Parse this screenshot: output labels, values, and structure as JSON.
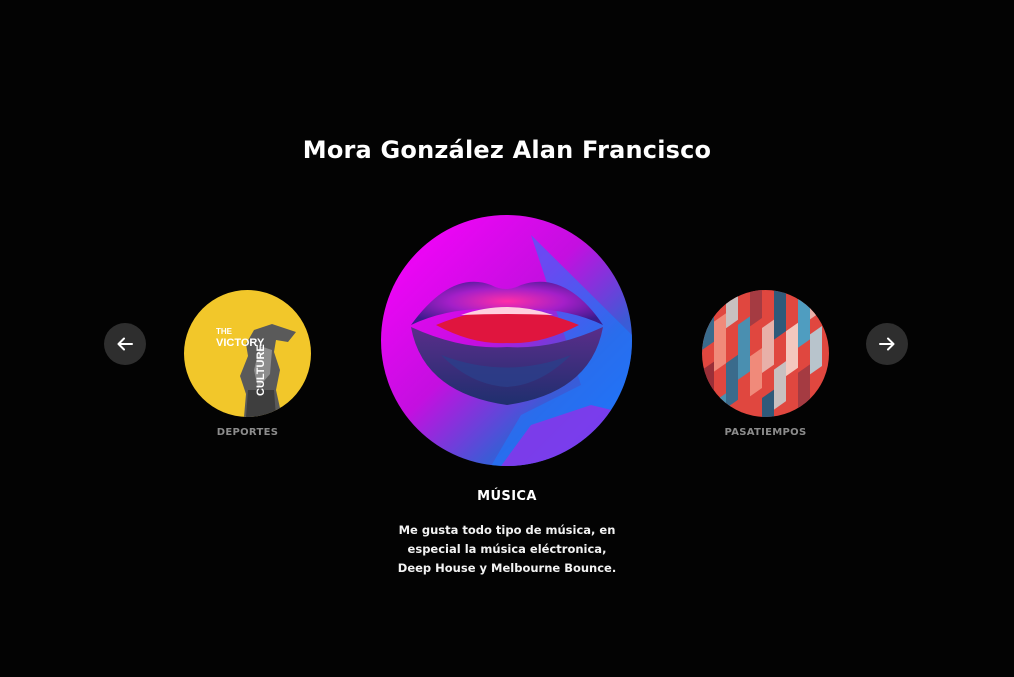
{
  "profile": {
    "name": "Mora González Alan Francisco"
  },
  "carousel": {
    "prev_icon": "arrow-left-icon",
    "next_icon": "arrow-right-icon",
    "slides": [
      {
        "label": "DEPORTES",
        "poster_line1": "THE",
        "poster_line2": "VICTORY",
        "poster_line3": "CULTURE",
        "accent": "#f2c72a"
      },
      {
        "label": "MÚSICA",
        "accent": "#ff00ff"
      },
      {
        "label": "PASATIEMPOS",
        "accent": "#e0473f"
      }
    ],
    "active": {
      "title": "MÚSICA",
      "description_lines": [
        "Me gusta todo tipo de música, en",
        "especial la música eléctronica,",
        "Deep House y Melbourne Bounce."
      ]
    }
  }
}
